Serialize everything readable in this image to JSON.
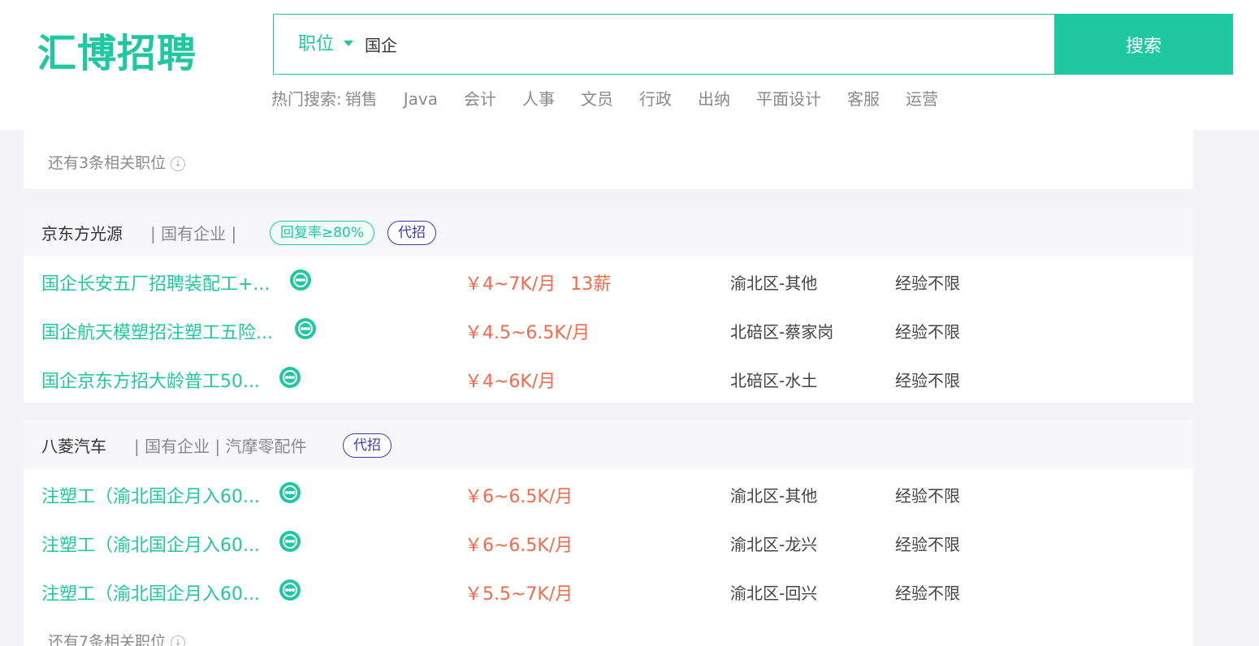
{
  "brand": {
    "logo_text": "汇博招聘",
    "color": "#1fc8a0"
  },
  "search": {
    "type_label": "职位",
    "query": "国企",
    "button_label": "搜索"
  },
  "hot_search": {
    "label": "热门搜索:",
    "items": [
      "销售",
      "Java",
      "会计",
      "人事",
      "文员",
      "行政",
      "出纳",
      "平面设计",
      "客服",
      "运营"
    ]
  },
  "more_top": {
    "label": "还有3条相关职位"
  },
  "companies": [
    {
      "name": "京东方光源",
      "meta": "| 国有企业 |",
      "tags": [
        "回复率≥80%",
        "代招"
      ],
      "jobs": [
        {
          "title": "国企长安五厂招聘装配工+...",
          "salary": "￥4~7K/月",
          "bonus": "13薪",
          "location": "渝北区-其他",
          "experience": "经验不限"
        },
        {
          "title": "国企航天模塑招注塑工五险...",
          "salary": "￥4.5~6.5K/月",
          "bonus": "",
          "location": "北碚区-蔡家岗",
          "experience": "经验不限"
        },
        {
          "title": "国企京东方招大龄普工50...",
          "salary": "￥4~6K/月",
          "bonus": "",
          "location": "北碚区-水土",
          "experience": "经验不限"
        }
      ]
    },
    {
      "name": "八菱汽车",
      "meta": "| 国有企业 | 汽摩零配件",
      "tags": [
        "代招"
      ],
      "jobs": [
        {
          "title": "注塑工（渝北国企月入60...",
          "salary": "￥6~6.5K/月",
          "bonus": "",
          "location": "渝北区-其他",
          "experience": "经验不限"
        },
        {
          "title": "注塑工（渝北国企月入60...",
          "salary": "￥6~6.5K/月",
          "bonus": "",
          "location": "渝北区-龙兴",
          "experience": "经验不限"
        },
        {
          "title": "注塑工（渝北国企月入60...",
          "salary": "￥5.5~7K/月",
          "bonus": "",
          "location": "渝北区-回兴",
          "experience": "经验不限"
        }
      ]
    }
  ],
  "more_bottom": {
    "label": "还有7条相关职位"
  },
  "icons": {
    "chat": "chat-bubble-icon",
    "dropdown": "caret-down-icon",
    "expand": "circle-down-icon"
  }
}
